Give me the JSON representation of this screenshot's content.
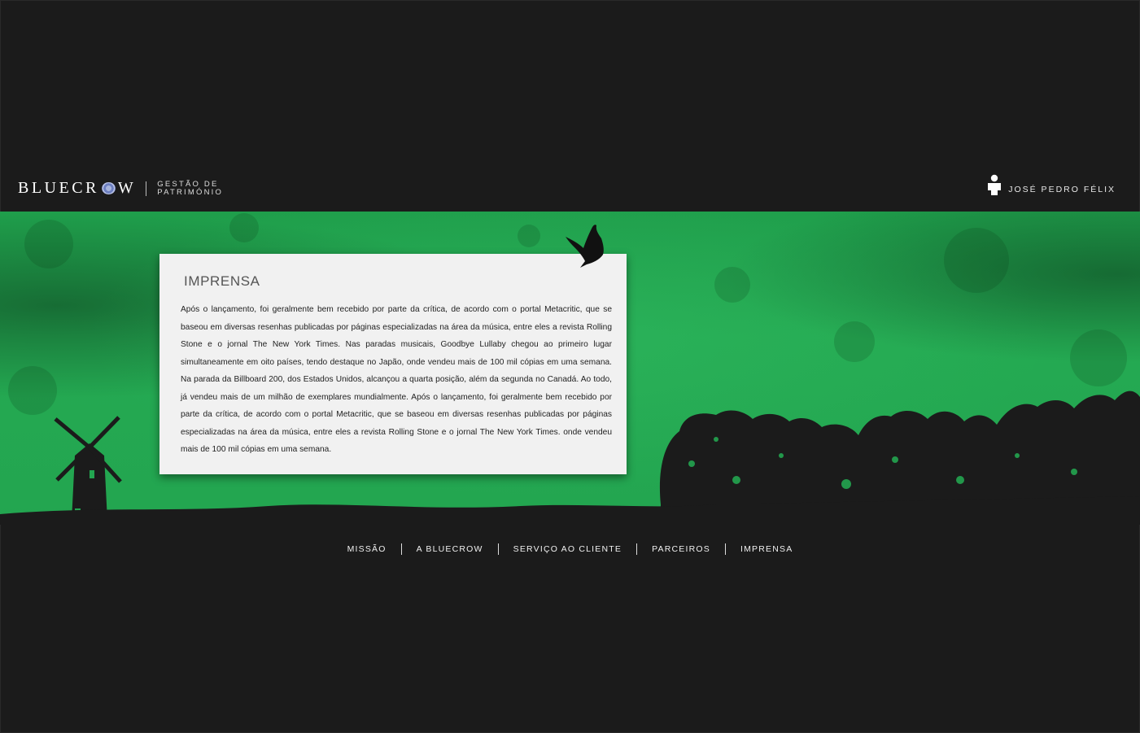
{
  "header": {
    "logo_part1": "BLUECR",
    "logo_part2": "W",
    "tagline_line1": "GESTÃO DE",
    "tagline_line2": "PATRIMÓNIO",
    "user_name": "JOSÉ PEDRO FÉLIX"
  },
  "card": {
    "title": "IMPRENSA",
    "body": "Após o lançamento, foi geralmente bem recebido por parte da crítica, de acordo com o portal Metacritic, que se baseou em diversas resenhas publicadas por páginas especializadas na área da música, entre eles a revista Rolling Stone e o jornal The New York Times. Nas paradas musicais, Goodbye Lullaby chegou ao primeiro lugar simultaneamente em oito países, tendo destaque no Japão, onde vendeu mais de 100 mil cópias em uma semana. Na parada da Billboard 200, dos Estados Unidos, alcançou a quarta posição, além da segunda no Canadá. Ao todo, já vendeu mais de um milhão de exemplares mundialmente. Após o lançamento, foi geralmente bem recebido por parte da crítica, de acordo com o portal Metacritic, que se baseou em diversas resenhas publicadas por páginas especializadas na área da música, entre eles a revista Rolling Stone e o jornal The New York Times. onde vendeu mais de 100 mil cópias em uma semana."
  },
  "nav": {
    "items": [
      {
        "label": "MISSÃO"
      },
      {
        "label": "A BLUECROW"
      },
      {
        "label": "SERVIÇO AO CLIENTE"
      },
      {
        "label": "PARCEIROS"
      },
      {
        "label": "IMPRENSA"
      }
    ]
  },
  "colors": {
    "background": "#1b1b1b",
    "hero_green": "#23a550",
    "card_bg": "#f1f1f1"
  },
  "icons": {
    "user": "user-icon",
    "bird": "crow-icon",
    "windmill": "windmill-illustration",
    "trees": "tree-line-illustration"
  }
}
